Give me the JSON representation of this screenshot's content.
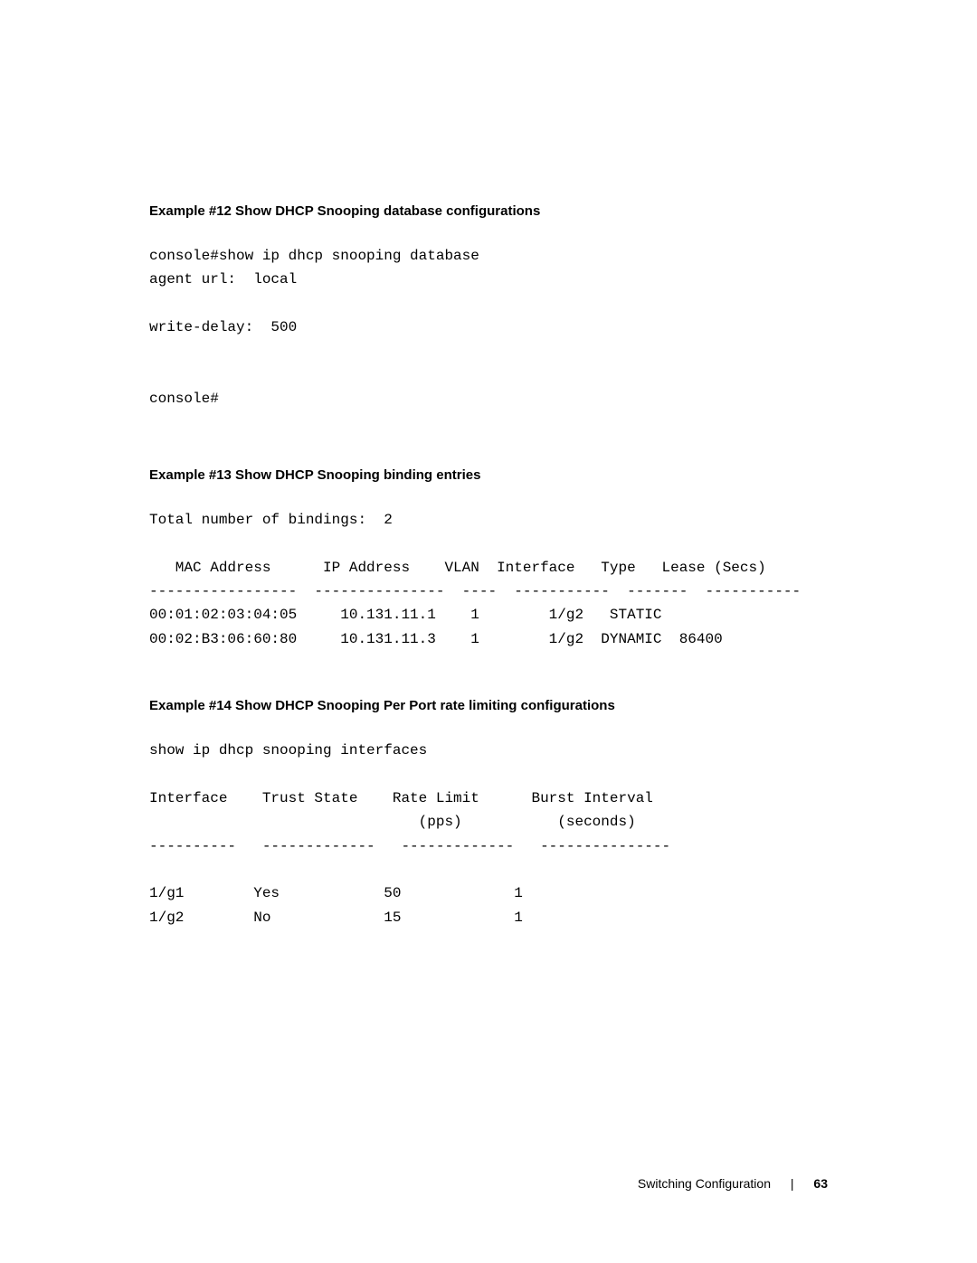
{
  "example12": {
    "title": "Example #12 Show DHCP Snooping database configurations",
    "block": "console#show ip dhcp snooping database\nagent url:  local\n\nwrite-delay:  500\n\n\nconsole#"
  },
  "example13": {
    "title": "Example #13 Show DHCP Snooping binding entries",
    "block": "Total number of bindings:  2\n\n   MAC Address      IP Address    VLAN  Interface   Type   Lease (Secs)\n-----------------  ---------------  ----  -----------  -------  -----------\n00:01:02:03:04:05     10.131.11.1    1        1/g2   STATIC\n00:02:B3:06:60:80     10.131.11.3    1        1/g2  DYNAMIC  86400"
  },
  "example14": {
    "title": "Example #14 Show DHCP Snooping Per Port rate limiting configurations",
    "block": "show ip dhcp snooping interfaces\n\nInterface    Trust State    Rate Limit      Burst Interval\n                               (pps)           (seconds)\n----------   -------------   -------------   ---------------\n\n1/g1        Yes            50             1\n1/g2        No             15             1"
  },
  "footer": {
    "section": "Switching Configuration",
    "page": "63"
  }
}
